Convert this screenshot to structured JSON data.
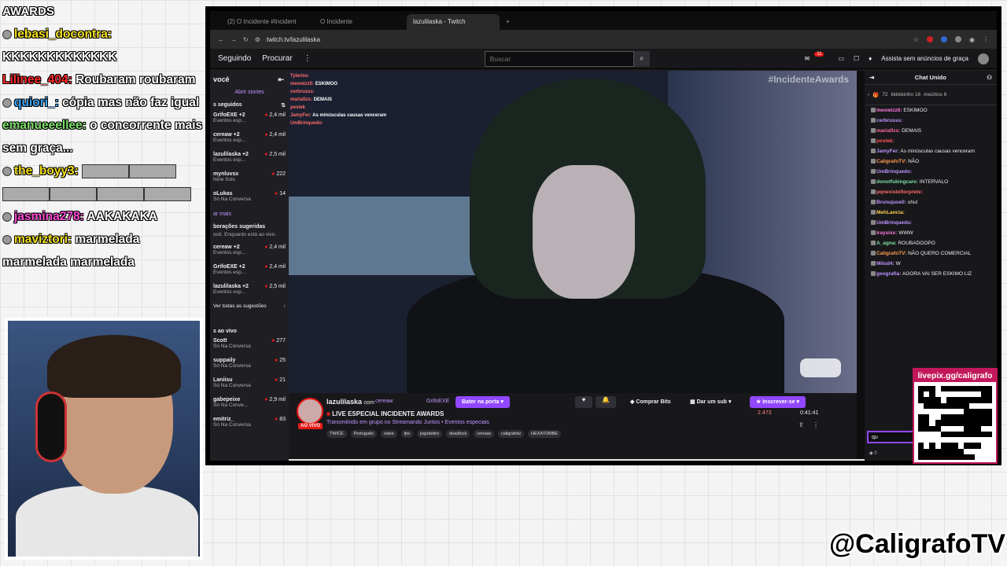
{
  "overlay": {
    "title": "AWARDS",
    "messages": [
      {
        "user": "lebasi_docontra:",
        "color": "#f5e21b",
        "text": "KKKKKKKKKKKKK",
        "badge": true
      },
      {
        "user": "Lilinee_404:",
        "color": "#ff2a2a",
        "text": "Roubaram roubaram",
        "badge": false
      },
      {
        "user": "quiori_:",
        "color": "#3aa7ff",
        "text": "cópia mas não faz igual",
        "badge": true
      },
      {
        "user": "emanueeellee:",
        "color": "#7ee06b",
        "text": "o concorrente mais sem graça...",
        "badge": false
      },
      {
        "user": "the_boyy3:",
        "color": "#f5e21b",
        "text": "",
        "badge": true,
        "emotes": 6
      },
      {
        "user": "jasmina278:",
        "color": "#ff4dd8",
        "text": "AAKAKAKA",
        "badge": true
      },
      {
        "user": "maviztori:",
        "color": "#f5e21b",
        "text": "marmelada marmelada marmelada",
        "badge": true
      }
    ]
  },
  "browser": {
    "tabs": [
      "(2) O Incidente #Incident",
      "O Incidente",
      "lazulilaska - Twitch",
      ""
    ],
    "url": "twitch.tv/lazulilaska"
  },
  "twitch": {
    "nav": {
      "following": "Seguindo",
      "browse": "Procurar",
      "more": "⋮",
      "search_placeholder": "Buscar",
      "notifications": "11",
      "turbo": "Assista sem anúncios de graça"
    },
    "sidebar": {
      "title": "você",
      "stories": "Abrir stories",
      "followed_header": "s seguidos",
      "followed": [
        {
          "name": "GrifoEXE +2",
          "sub": "Eventos esp...",
          "viewers": "2,4 mil"
        },
        {
          "name": "cereaw +2",
          "sub": "Eventos esp...",
          "viewers": "2,4 mil"
        },
        {
          "name": "lazulilaska +2",
          "sub": "Eventos esp...",
          "viewers": "2,5 mil"
        },
        {
          "name": "mynluvsx",
          "sub": "Nine Sols",
          "viewers": "222"
        },
        {
          "name": "oLukas",
          "sub": "Só Na Conversa",
          "viewers": "14"
        }
      ],
      "show_more": "ar mais",
      "suggested_header": "borações sugeridas",
      "suggested_sub": "ocê. Enquanto está ao vivo.",
      "suggested": [
        {
          "name": "cereaw +2",
          "sub": "Eventos esp...",
          "viewers": "2,4 mil"
        },
        {
          "name": "GrifoEXE +2",
          "sub": "Eventos esp...",
          "viewers": "2,4 mil"
        },
        {
          "name": "lazulilaska +2",
          "sub": "Eventos esp...",
          "viewers": "2,5 mil"
        }
      ],
      "see_all": "Ver todas as sugestões",
      "live_header": "s ao vivo",
      "live": [
        {
          "name": "Scott",
          "sub": "Só Na Conversa",
          "viewers": "277"
        },
        {
          "name": "suppaily",
          "sub": "Só Na Conversa",
          "viewers": "25"
        },
        {
          "name": "Laniisu",
          "sub": "Só Na Conversa",
          "viewers": "21"
        },
        {
          "name": "gabepeixe",
          "sub": "Só Na Conve...",
          "viewers": "2,9 mil"
        },
        {
          "name": "emitriz_",
          "sub": "Só Na Conversa",
          "viewers": "83"
        }
      ]
    },
    "video": {
      "hashtag": "#IncidenteAwards",
      "overlay_chat": [
        {
          "user": "Tylerino",
          "text": ""
        },
        {
          "user": "meowizz0:",
          "text": "ESKIMOO"
        },
        {
          "user": "cerbrusss:",
          "text": ""
        },
        {
          "user": "mariafizs:",
          "text": "DEMAIS"
        },
        {
          "user": "pestek",
          "text": ""
        },
        {
          "user": "JamyFer:",
          "text": "As minúsculas causas venceram"
        },
        {
          "user": "UmBrinquedo:",
          "text": ""
        }
      ]
    },
    "stream": {
      "streamer": "lazulilaska",
      "with": "com",
      "collab1": "cereaw",
      "collab2": "GrifoEXE",
      "raid": "Bater na porta",
      "live_badge": "AO VIVO",
      "title": "LIVE ESPECIAL INCIDENTE AWARDS",
      "group": "Transmitindo em grupo no Streamando Juntos • Eventos especiais",
      "tags": [
        "TWICE",
        "Português",
        "valve",
        "fps",
        "jogodetiro",
        "deadlock",
        "cereaw",
        "caligrafotv",
        "HEXATOMBE"
      ],
      "bits": "Comprar Bits",
      "gift": "Dar um sub",
      "subscribe": "Inscrever-se",
      "viewers": "2.473",
      "uptime": "0:41:41"
    },
    "chat": {
      "header": "Chat Unido",
      "hype": [
        {
          "user": "kkkkkinho",
          "count": "16"
        },
        {
          "user": "meizitos",
          "count": "6"
        },
        {
          "count": "72"
        }
      ],
      "messages": [
        {
          "user": "meowizz0:",
          "color": "#ff7be0",
          "text": "ESKIMOO"
        },
        {
          "user": "cerbrusss:",
          "color": "#bf94ff",
          "text": ""
        },
        {
          "user": "mariafizs:",
          "color": "#ff6b9e",
          "text": "DEMAIS"
        },
        {
          "user": "pestek:",
          "color": "#ff5555",
          "text": ""
        },
        {
          "user": "JamyFer:",
          "color": "#bf94ff",
          "text": "As minúsculas causas venceram"
        },
        {
          "user": "CaligrafoTV:",
          "color": "#ff9b4d",
          "text": "NÃO"
        },
        {
          "user": "UmBrinquedo:",
          "color": "#bf94ff",
          "text": ""
        },
        {
          "user": "donotfukingcare:",
          "color": "#7be0a0",
          "text": "INTERVALO"
        },
        {
          "user": "pqnexistefiorprete:",
          "color": "#ff6b6b",
          "text": ""
        },
        {
          "user": "Brunujuse0:",
          "color": "#bf94ff",
          "text": "uhul"
        },
        {
          "user": "MehLancia:",
          "color": "#ffd24d",
          "text": ""
        },
        {
          "user": "UmBrinquedo:",
          "color": "#bf94ff",
          "text": ""
        },
        {
          "user": "iraysixx:",
          "color": "#ff7be0",
          "text": "WWW"
        },
        {
          "user": "A_agna:",
          "color": "#7be0a0",
          "text": "ROUBADOOPO"
        },
        {
          "user": "CaligrafoTV:",
          "color": "#ff9b4d",
          "text": "NÃO QUERO COMERCIAL"
        },
        {
          "user": "Milud4:",
          "color": "#bf94ff",
          "text": "W"
        },
        {
          "user": "geografia:",
          "color": "#bf94ff",
          "text": "AGORA VAI SER ESKIMO LIZ"
        }
      ],
      "input_value": "qu",
      "footer": "0"
    }
  },
  "qr": {
    "label": "livepix.gg/caligrafo"
  },
  "handle": "@CaligrafoTV"
}
